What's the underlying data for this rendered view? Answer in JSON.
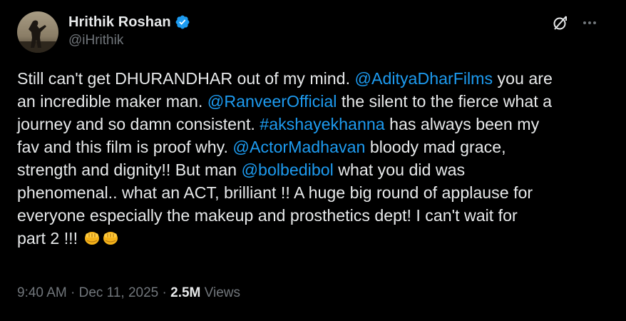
{
  "author": {
    "display_name": "Hrithik Roshan",
    "handle": "@iHrithik",
    "verified": true
  },
  "icons": {
    "verified": "verified-badge-icon",
    "grok": "grok-icon",
    "more": "more-icon",
    "emoji": "oncoming-fist-emoji"
  },
  "colors": {
    "background": "#000000",
    "text": "#e7e9ea",
    "secondary": "#71767b",
    "link": "#1d9bf0"
  },
  "tweet": {
    "lines": [
      [
        {
          "text": "Still can't get DHURANDHAR out of my mind. ",
          "type": "text"
        },
        {
          "text": "@AdityaDharFilms",
          "type": "mention"
        },
        {
          "text": " you are",
          "type": "text"
        }
      ],
      [
        {
          "text": "an incredible maker man. ",
          "type": "text"
        },
        {
          "text": "@RanveerOfficial",
          "type": "mention"
        },
        {
          "text": " the silent to the fierce what a",
          "type": "text"
        }
      ],
      [
        {
          "text": "journey and so damn consistent. ",
          "type": "text"
        },
        {
          "text": "#akshayekhanna",
          "type": "hashtag"
        },
        {
          "text": " has always been my",
          "type": "text"
        }
      ],
      [
        {
          "text": "fav and this film is proof why. ",
          "type": "text"
        },
        {
          "text": "@ActorMadhavan",
          "type": "mention"
        },
        {
          "text": " bloody mad grace,",
          "type": "text"
        }
      ],
      [
        {
          "text": "strength and dignity!! But man ",
          "type": "text"
        },
        {
          "text": "@bolbedibol",
          "type": "mention"
        },
        {
          "text": " what you did was",
          "type": "text"
        }
      ],
      [
        {
          "text": "phenomenal.. what an ACT, brilliant !! A huge big round of applause for",
          "type": "text"
        }
      ],
      [
        {
          "text": "everyone especially the makeup and prosthetics dept! I can't wait for",
          "type": "text"
        }
      ],
      [
        {
          "text": "part 2 !!! ",
          "type": "text"
        },
        {
          "text": "👊",
          "type": "emoji"
        },
        {
          "text": "👊",
          "type": "emoji"
        }
      ]
    ]
  },
  "meta": {
    "time": "9:40 AM",
    "separator": " · ",
    "date": "Dec 11, 2025",
    "separator2": " · ",
    "views_count": "2.5M",
    "views_label": " Views"
  }
}
